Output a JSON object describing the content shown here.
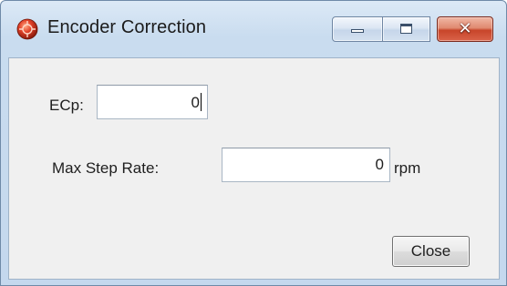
{
  "window": {
    "title": "Encoder Correction",
    "icon": "app-logo-icon",
    "caption_buttons": {
      "minimize_icon": "minimize-icon",
      "maximize_icon": "maximize-icon",
      "close_glyph": "✕",
      "close_color": "#c8452a"
    }
  },
  "form": {
    "ecp": {
      "label": "ECp:",
      "value": "0"
    },
    "max_step_rate": {
      "label": "Max Step Rate:",
      "value": "0",
      "unit": "rpm"
    }
  },
  "footer": {
    "close_label": "Close"
  }
}
